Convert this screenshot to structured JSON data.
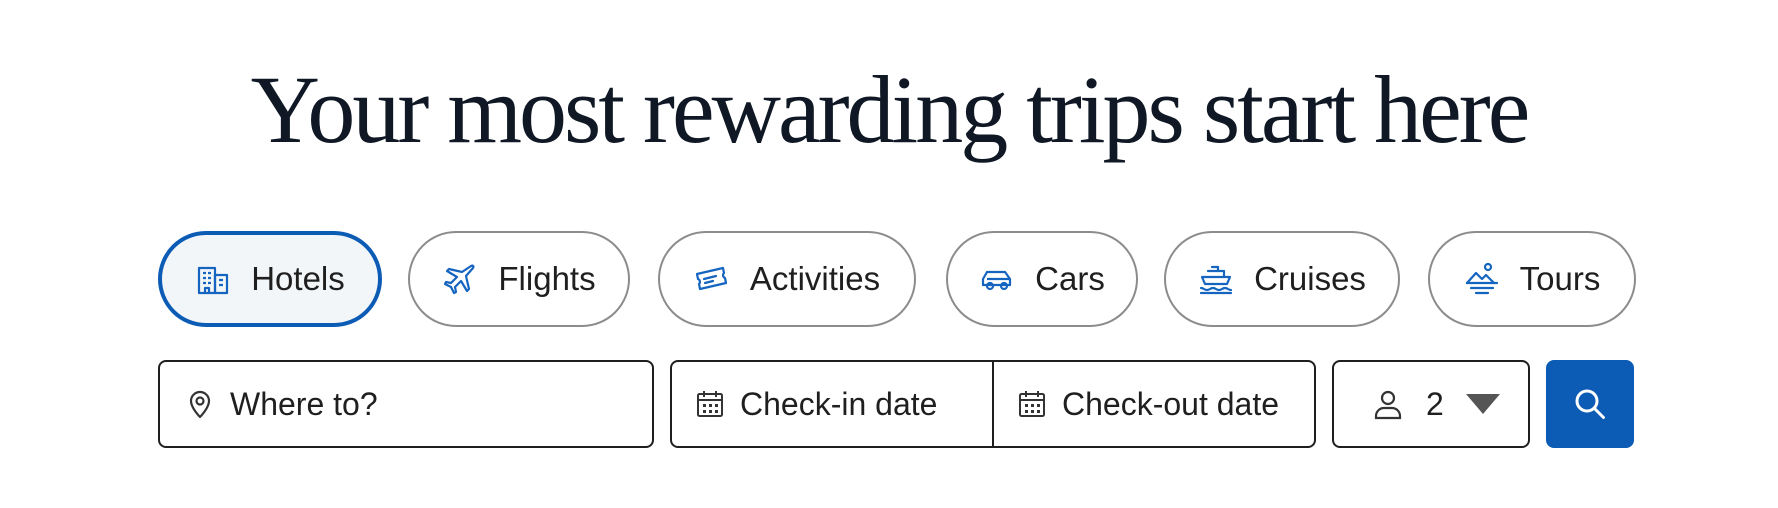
{
  "headline": "Your most rewarding trips start here",
  "tabs": [
    {
      "label": "Hotels",
      "icon": "hotel-building-icon",
      "active": true
    },
    {
      "label": "Flights",
      "icon": "airplane-icon",
      "active": false
    },
    {
      "label": "Activities",
      "icon": "ticket-icon",
      "active": false
    },
    {
      "label": "Cars",
      "icon": "car-icon",
      "active": false
    },
    {
      "label": "Cruises",
      "icon": "cruise-ship-icon",
      "active": false
    },
    {
      "label": "Tours",
      "icon": "tour-landscape-icon",
      "active": false
    }
  ],
  "search": {
    "destination_placeholder": "Where to?",
    "checkin_placeholder": "Check-in date",
    "checkout_placeholder": "Check-out date",
    "guests_value": "2",
    "search_icon": "search-icon"
  },
  "colors": {
    "accent": "#0c5bb5",
    "icon_blue": "#1565c0",
    "text_dark": "#0f1824",
    "border_gray": "#8c8c8c",
    "active_tab_bg": "#f3f6f9"
  }
}
